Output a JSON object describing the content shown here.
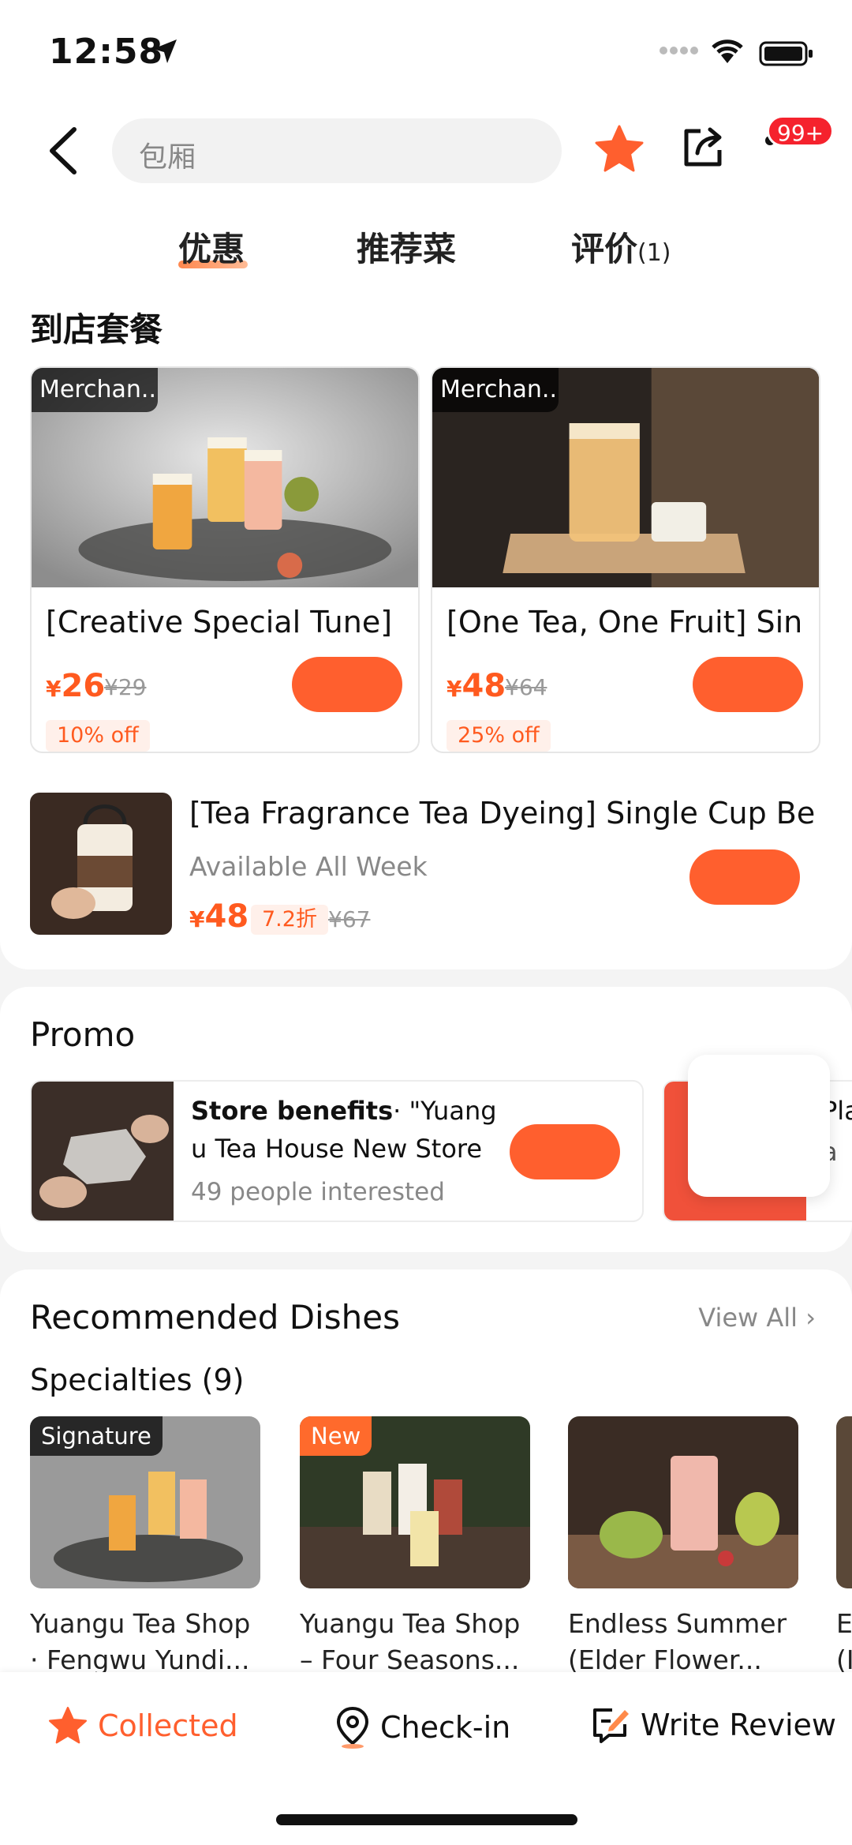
{
  "status_bar": {
    "time": "12:58"
  },
  "nav": {
    "search_placeholder": "包厢",
    "badge": "99+"
  },
  "tabs": [
    {
      "label": "优惠"
    },
    {
      "label": "推荐菜"
    },
    {
      "label": "评价",
      "count": "(1)"
    }
  ],
  "package_section": {
    "title": "到店套餐",
    "deals": [
      {
        "tag": "Merchan...",
        "name": "[Creative Special Tune]",
        "price": "26",
        "orig": "¥29",
        "discount": "10% off"
      },
      {
        "tag": "Merchan...",
        "name": "[One Tea, One Fruit] Sin",
        "price": "48",
        "orig": "¥64",
        "discount": "25% off"
      }
    ],
    "row_deal": {
      "name": "[Tea Fragrance Tea Dyeing] Single Cup Be",
      "sub": "Available All Week",
      "price": "48",
      "discount": "7.2折",
      "orig": "¥67"
    },
    "currency": "¥"
  },
  "promo": {
    "title": "Promo",
    "card": {
      "bold": "Store benefits",
      "sep": "·",
      "line1": " \"Yuang",
      "line2": "u Tea House New Store",
      "line3": "49 people interested"
    },
    "card2_text1": "Pla",
    "card2_text2": "a"
  },
  "recommended": {
    "title": "Recommended Dishes",
    "view_all": "View All",
    "subtitle": "Specialties (9)",
    "dishes": [
      {
        "tag": "Signature",
        "line1": "Yuangu Tea Shop",
        "line2": "· Fengwu Yundi..."
      },
      {
        "tag": "New",
        "line1": "Yuangu Tea Shop",
        "line2": "– Four Seasons..."
      },
      {
        "tag": "",
        "line1": "Endless Summer",
        "line2": "(Elder Flower..."
      },
      {
        "tag": "",
        "line1": "E",
        "line2": "(I"
      }
    ]
  },
  "bottom_bar": {
    "collected": "Collected",
    "checkin": "Check-in",
    "review": "Write Review"
  },
  "colors": {
    "accent": "#ff5f2e",
    "price": "#ff5a1f"
  }
}
